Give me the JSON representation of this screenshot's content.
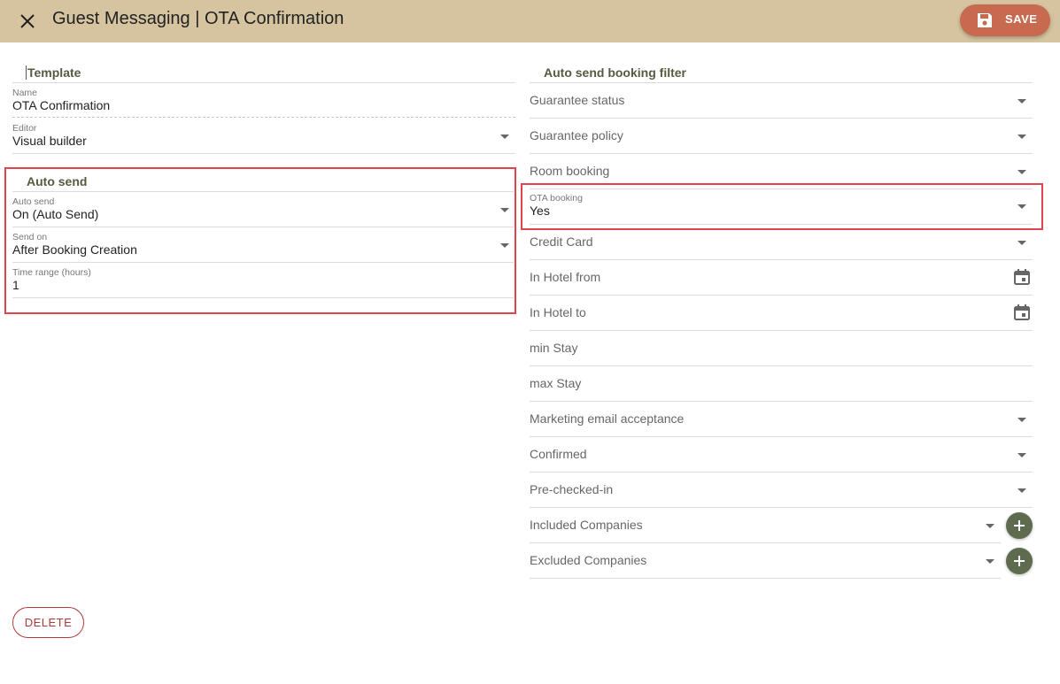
{
  "header": {
    "title": "Guest Messaging | OTA Confirmation",
    "save_label": "SAVE",
    "close_icon": "close-icon",
    "save_icon": "floppy-disk-icon"
  },
  "colors": {
    "header_bg": "#d5c49f",
    "save_button": "#c76a50",
    "section_title": "#555b40",
    "highlight": "#e0434e",
    "add_button": "#5e6b4e",
    "delete": "#b03a3a"
  },
  "template": {
    "title": "Template",
    "name": {
      "label": "Name",
      "value": "OTA Confirmation"
    },
    "editor": {
      "label": "Editor",
      "value": "Visual builder"
    }
  },
  "auto_send": {
    "title": "Auto send",
    "auto_send": {
      "label": "Auto send",
      "value": "On (Auto Send)"
    },
    "send_on": {
      "label": "Send on",
      "value": "After Booking Creation"
    },
    "time_range": {
      "label": "Time range (hours)",
      "value": "1"
    }
  },
  "filter": {
    "title": "Auto send booking filter",
    "guarantee_status": "Guarantee status",
    "guarantee_policy": "Guarantee policy",
    "room_booking": "Room booking",
    "ota_booking": {
      "label": "OTA booking",
      "value": "Yes"
    },
    "credit_card": "Credit Card",
    "in_hotel_from": "In Hotel from",
    "in_hotel_to": "In Hotel to",
    "min_stay": "min Stay",
    "max_stay": "max Stay",
    "marketing": "Marketing email acceptance",
    "confirmed": "Confirmed",
    "pre_checked_in": "Pre-checked-in",
    "included_companies": "Included Companies",
    "excluded_companies": "Excluded Companies"
  },
  "footer": {
    "delete_label": "DELETE"
  }
}
